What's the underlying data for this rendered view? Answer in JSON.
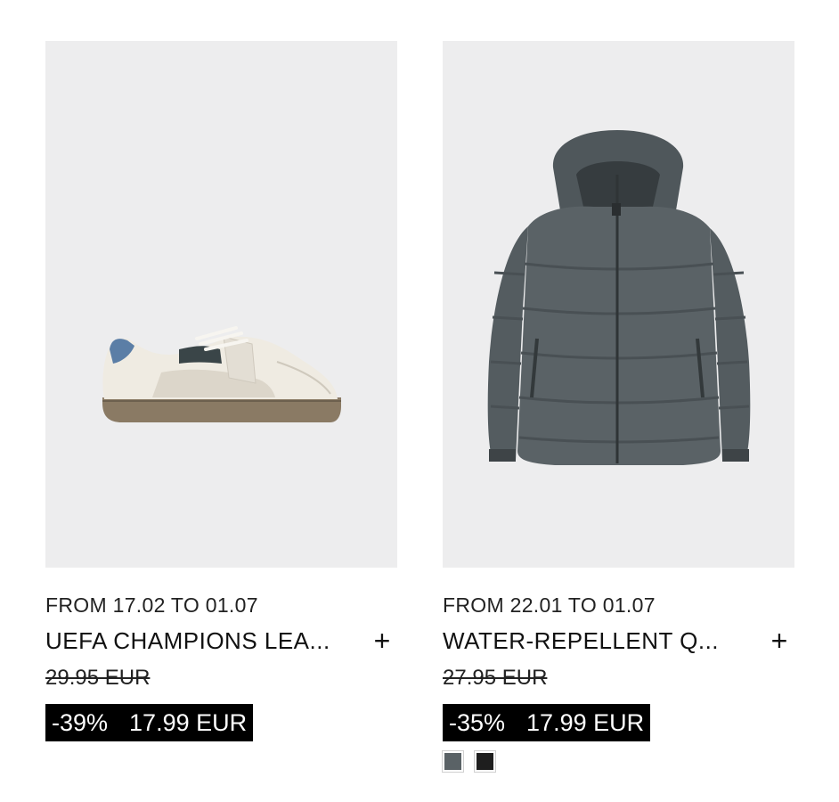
{
  "products": [
    {
      "date": "FROM 17.02 TO 01.07",
      "name": "UEFA CHAMPIONS LEA...",
      "old_price": "29.95 EUR",
      "discount": "-39%",
      "price": "17.99 EUR",
      "image_icon": "sneaker-image"
    },
    {
      "date": "FROM 22.01 TO 01.07",
      "name": "WATER-REPELLENT Q...",
      "old_price": "27.95 EUR",
      "discount": "-35%",
      "price": "17.99 EUR",
      "image_icon": "puffer-jacket-image",
      "swatches": [
        "#5a6266",
        "#1e1e1e"
      ]
    }
  ],
  "add_icon": "plus-icon"
}
